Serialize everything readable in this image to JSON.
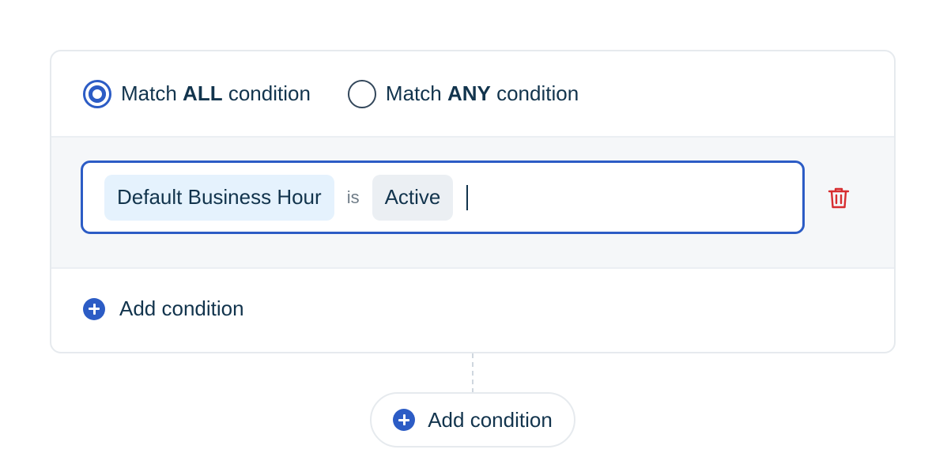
{
  "match": {
    "all": {
      "prefix": "Match",
      "keyword": "ALL",
      "suffix": "condition",
      "selected": true
    },
    "any": {
      "prefix": "Match",
      "keyword": "ANY",
      "suffix": "condition",
      "selected": false
    }
  },
  "condition": {
    "field": "Default Business Hour",
    "operator": "is",
    "value": "Active"
  },
  "actions": {
    "add_condition_label": "Add condition",
    "add_condition_outer_label": "Add condition",
    "delete_icon": "trash-icon",
    "add_icon": "plus-circle-icon"
  },
  "colors": {
    "accent": "#2c5cc5",
    "delete": "#d72d30",
    "field_token_bg": "#e5f2fd",
    "value_token_bg": "#ebeff3"
  }
}
